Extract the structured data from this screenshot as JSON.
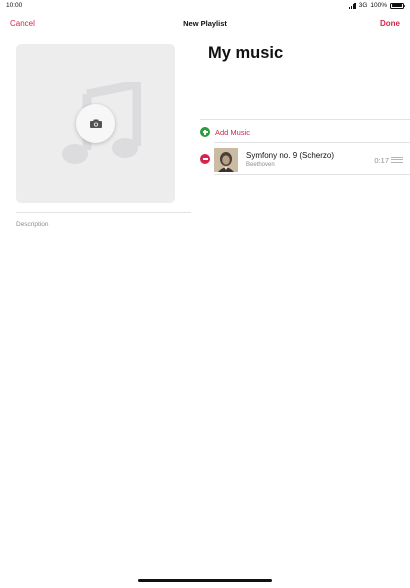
{
  "status_bar": {
    "time": "10:00",
    "network": "3G",
    "battery": "100%"
  },
  "nav": {
    "cancel_label": "Cancel",
    "title": "New Playlist",
    "done_label": "Done"
  },
  "artwork": {
    "placeholder_icon": "music-note-icon",
    "camera_icon": "camera-icon"
  },
  "description": {
    "placeholder": "Description"
  },
  "playlist": {
    "title": "My music",
    "add_music_label": "Add Music",
    "tracks": [
      {
        "title": "Symfony no. 9 (Scherzo)",
        "artist": "Beethoven",
        "duration": "0:17"
      }
    ]
  },
  "colors": {
    "accent": "#d7244a",
    "add_green": "#2e9b3e",
    "secondary_text": "#8e8e93",
    "artwork_bg": "#ededee"
  }
}
